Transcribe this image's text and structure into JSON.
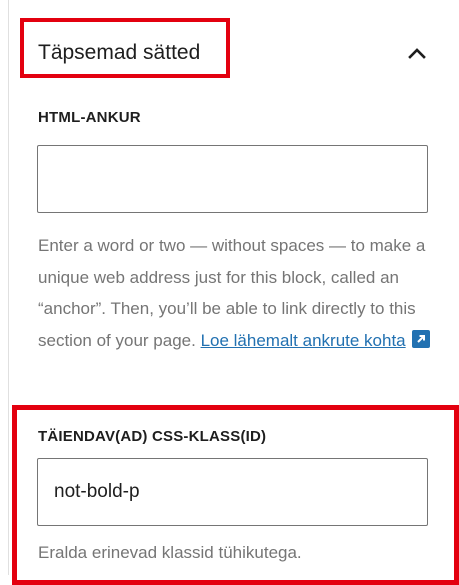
{
  "panel": {
    "title": "Täpsemad sätted",
    "toggle_icon": "chevron-up-icon",
    "expanded": true
  },
  "html_anchor": {
    "label": "HTML-ANKUR",
    "value": "",
    "help_text": "Enter a word or two — without spaces — to make a unique web address just for this block, called an “anchor”. Then, you’ll be able to link directly to this section of your page.",
    "link_text": "Loe lähemalt ankrute kohta",
    "link_icon": "external-link-icon"
  },
  "css_classes": {
    "label": "TÄIENDAV(AD) CSS-KLASS(ID)",
    "value": "not-bold-p",
    "help_text": "Eralda erinevad klassid tühikutega."
  },
  "colors": {
    "highlight": "#e3000f",
    "link": "#2271b1",
    "muted_text": "#757575"
  }
}
